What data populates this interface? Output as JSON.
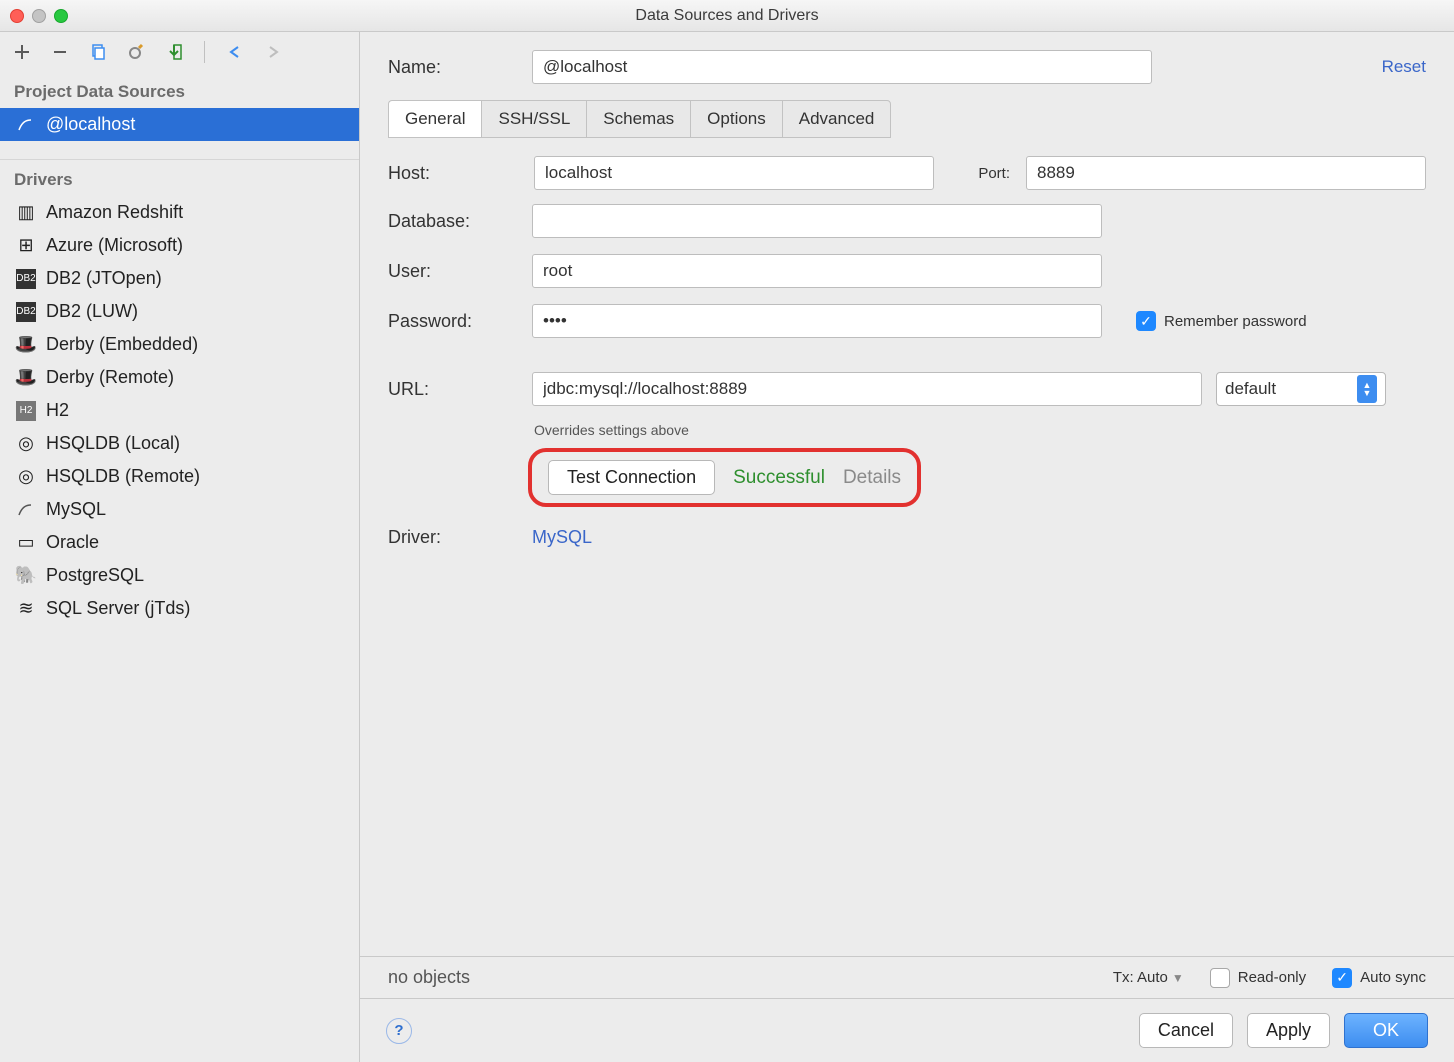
{
  "window": {
    "title": "Data Sources and Drivers"
  },
  "sidebar": {
    "ds_header": "Project Data Sources",
    "ds_items": [
      {
        "label": "@localhost"
      }
    ],
    "drv_header": "Drivers",
    "drivers": [
      {
        "label": "Amazon Redshift"
      },
      {
        "label": "Azure (Microsoft)"
      },
      {
        "label": "DB2 (JTOpen)"
      },
      {
        "label": "DB2 (LUW)"
      },
      {
        "label": "Derby (Embedded)"
      },
      {
        "label": "Derby (Remote)"
      },
      {
        "label": "H2"
      },
      {
        "label": "HSQLDB (Local)"
      },
      {
        "label": "HSQLDB (Remote)"
      },
      {
        "label": "MySQL"
      },
      {
        "label": "Oracle"
      },
      {
        "label": "PostgreSQL"
      },
      {
        "label": "SQL Server (jTds)"
      }
    ]
  },
  "form": {
    "name_label": "Name:",
    "name": "@localhost",
    "reset": "Reset",
    "tabs": [
      "General",
      "SSH/SSL",
      "Schemas",
      "Options",
      "Advanced"
    ],
    "host_label": "Host:",
    "host": "localhost",
    "port_label": "Port:",
    "port": "8889",
    "db_label": "Database:",
    "db": "",
    "user_label": "User:",
    "user": "root",
    "pwd_label": "Password:",
    "pwd": "••••",
    "remember": "Remember password",
    "url_label": "URL:",
    "url": "jdbc:mysql://localhost:8889",
    "url_mode": "default",
    "url_note": "Overrides settings above",
    "test_btn": "Test Connection",
    "test_status": "Successful",
    "details": "Details",
    "driver_label": "Driver:",
    "driver": "MySQL"
  },
  "status": {
    "objects": "no objects",
    "tx_label": "Tx:",
    "tx_value": "Auto",
    "readonly": "Read-only",
    "autosync": "Auto sync"
  },
  "footer": {
    "cancel": "Cancel",
    "apply": "Apply",
    "ok": "OK"
  }
}
